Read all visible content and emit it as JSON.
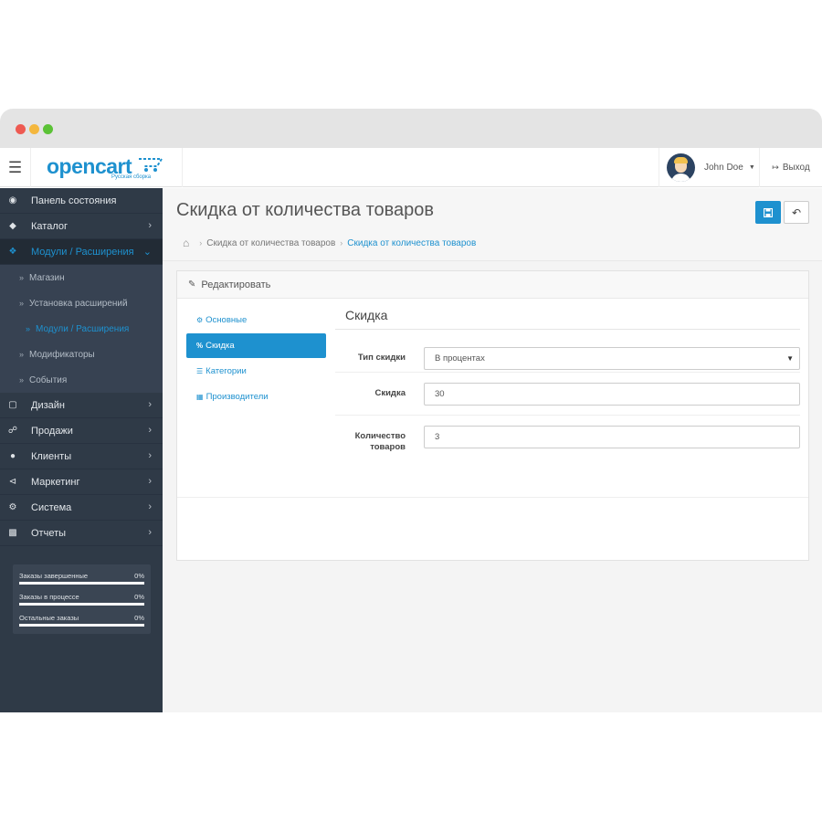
{
  "header": {
    "logo_text": "opencart",
    "logo_sub": "Русская сборка",
    "user_name": "John Doe",
    "logout_label": "Выход"
  },
  "sidebar": {
    "items": [
      {
        "label": "Панель состояния",
        "icon": "dashboard-icon"
      },
      {
        "label": "Каталог",
        "icon": "tag-icon"
      },
      {
        "label": "Модули / Расширения",
        "icon": "puzzle-icon"
      },
      {
        "label": "Дизайн",
        "icon": "monitor-icon"
      },
      {
        "label": "Продажи",
        "icon": "cart-icon"
      },
      {
        "label": "Клиенты",
        "icon": "user-icon"
      },
      {
        "label": "Маркетинг",
        "icon": "share-icon"
      },
      {
        "label": "Система",
        "icon": "gear-icon"
      },
      {
        "label": "Отчеты",
        "icon": "bar-chart-icon"
      }
    ],
    "submenu": [
      {
        "label": "Магазин"
      },
      {
        "label": "Установка расширений"
      },
      {
        "label": "Модули / Расширения"
      },
      {
        "label": "Модификаторы"
      },
      {
        "label": "События"
      }
    ],
    "stats": [
      {
        "label": "Заказы завершенные",
        "value": "0%"
      },
      {
        "label": "Заказы в процессе",
        "value": "0%"
      },
      {
        "label": "Остальные заказы",
        "value": "0%"
      }
    ]
  },
  "page": {
    "title": "Скидка от количества товаров",
    "breadcrumb": [
      "Скидка от количества товаров",
      "Скидка от количества товаров"
    ]
  },
  "panel": {
    "heading": "Редактировать",
    "tabs": [
      "Основные",
      "Скидка",
      "Категории",
      "Производители"
    ],
    "legend": "Скидка",
    "fields": {
      "discount_type_label": "Тип скидки",
      "discount_type_value": "В процентах",
      "discount_label": "Скидка",
      "discount_value": "30",
      "quantity_label": "Количество товаров",
      "quantity_value": "3"
    }
  },
  "colors": {
    "accent": "#1e91cf",
    "sidebar_bg": "#2f3a47"
  }
}
